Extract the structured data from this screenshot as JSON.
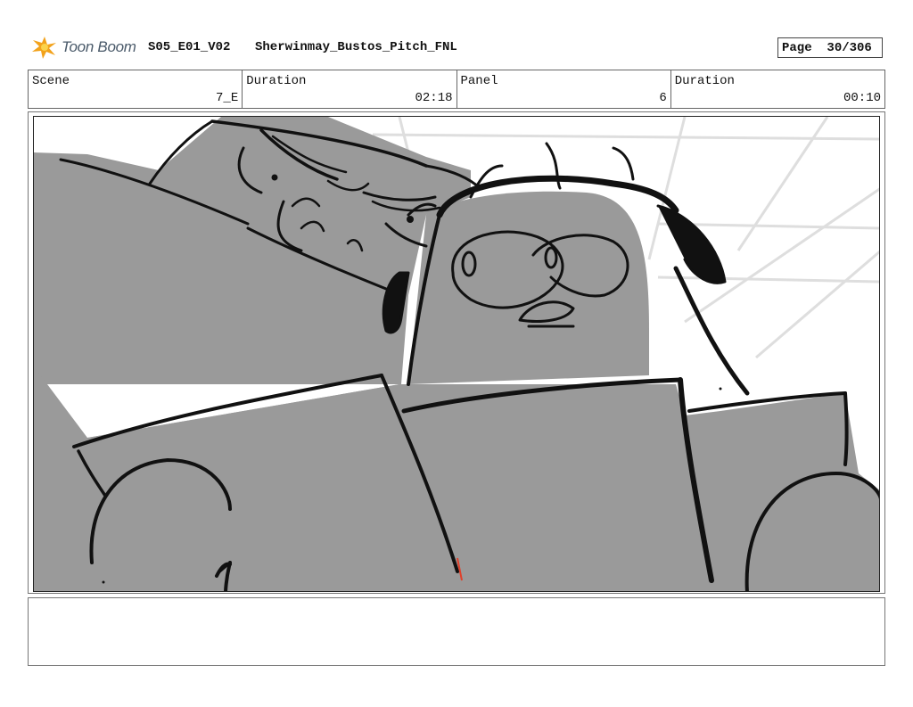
{
  "header": {
    "logo_text": "Toon Boom",
    "episode": "S05_E01_V02",
    "project": "Sherwinmay_Bustos_Pitch_FNL",
    "page_label": "Page",
    "page_number": "30/306"
  },
  "info": {
    "scene_label": "Scene",
    "scene_value": "7_E",
    "scene_duration_label": "Duration",
    "scene_duration_value": "02:18",
    "panel_label": "Panel",
    "panel_value": "6",
    "panel_duration_label": "Duration",
    "panel_duration_value": "00:10"
  },
  "notes": {
    "text": ""
  },
  "colors": {
    "fill_gray": "#9a9a9a",
    "ink": "#111111",
    "guide_lines": "#dedede",
    "accent_red": "#e0402a",
    "logo_orange": "#f2a21b"
  }
}
